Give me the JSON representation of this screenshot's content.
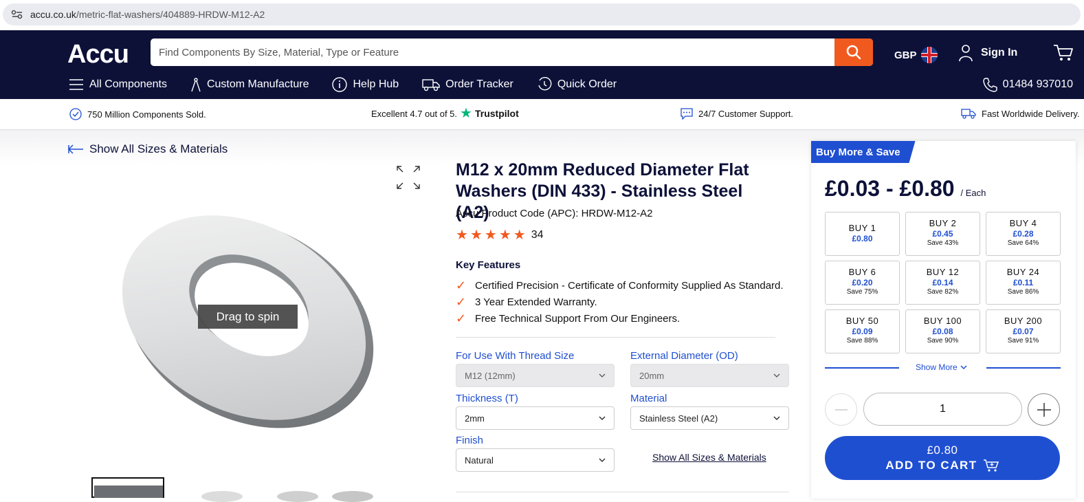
{
  "browser": {
    "url_host": "accu.co.uk",
    "url_path": "/metric-flat-washers/404889-HRDW-M12-A2"
  },
  "header": {
    "logo": "Accu",
    "search_placeholder": "Find Components By Size, Material, Type or Feature",
    "currency": "GBP",
    "sign_in": "Sign In",
    "nav": [
      "All Components",
      "Custom Manufacture",
      "Help Hub",
      "Order Tracker",
      "Quick Order"
    ],
    "phone": "01484 937010"
  },
  "trust_bar": {
    "sold": "750 Million Components Sold.",
    "rating_text": "Excellent 4.7 out of 5.",
    "trustpilot": "Trustpilot",
    "support": "24/7 Customer Support.",
    "delivery": "Fast Worldwide Delivery."
  },
  "gallery": {
    "back_link": "Show All Sizes & Materials",
    "spin_label": "Drag to spin"
  },
  "product": {
    "title": "M12 x 20mm Reduced Diameter Flat Washers (DIN 433) - Stainless Steel (A2)",
    "apc": "Accu Product Code (APC): HRDW-M12-A2",
    "rating_stars": 5,
    "review_count": "34",
    "key_features_title": "Key Features",
    "features": [
      "Certified Precision - Certificate of Conformity Supplied As Standard.",
      "3 Year Extended Warranty.",
      "Free Technical Support From Our Engineers."
    ]
  },
  "options": {
    "thread_label": "For Use With Thread Size",
    "thread_value": "M12 (12mm)",
    "od_label": "External Diameter (OD)",
    "od_value": "20mm",
    "thickness_label": "Thickness (T)",
    "thickness_value": "2mm",
    "material_label": "Material",
    "material_value": "Stainless Steel (A2)",
    "finish_label": "Finish",
    "finish_value": "Natural",
    "show_all": "Show All Sizes & Materials"
  },
  "buy_panel": {
    "badge": "Buy More & Save",
    "price_range": "£0.03 - £0.80",
    "per": "/ Each",
    "tiers": [
      {
        "qty": "BUY 1",
        "price": "£0.80",
        "save": ""
      },
      {
        "qty": "BUY 2",
        "price": "£0.45",
        "save": "Save 43%"
      },
      {
        "qty": "BUY 4",
        "price": "£0.28",
        "save": "Save 64%"
      },
      {
        "qty": "BUY 6",
        "price": "£0.20",
        "save": "Save 75%"
      },
      {
        "qty": "BUY 12",
        "price": "£0.14",
        "save": "Save 82%"
      },
      {
        "qty": "BUY 24",
        "price": "£0.11",
        "save": "Save 86%"
      },
      {
        "qty": "BUY 50",
        "price": "£0.09",
        "save": "Save 88%"
      },
      {
        "qty": "BUY 100",
        "price": "£0.08",
        "save": "Save 90%"
      },
      {
        "qty": "BUY 200",
        "price": "£0.07",
        "save": "Save 91%"
      }
    ],
    "show_more": "Show More",
    "quantity": "1",
    "cart_price": "£0.80",
    "cart_label": "ADD TO CART"
  },
  "colors": {
    "navy": "#0d1138",
    "orange": "#f15a1f",
    "blue": "#1f4fd1",
    "trustpilot": "#00b67a"
  }
}
